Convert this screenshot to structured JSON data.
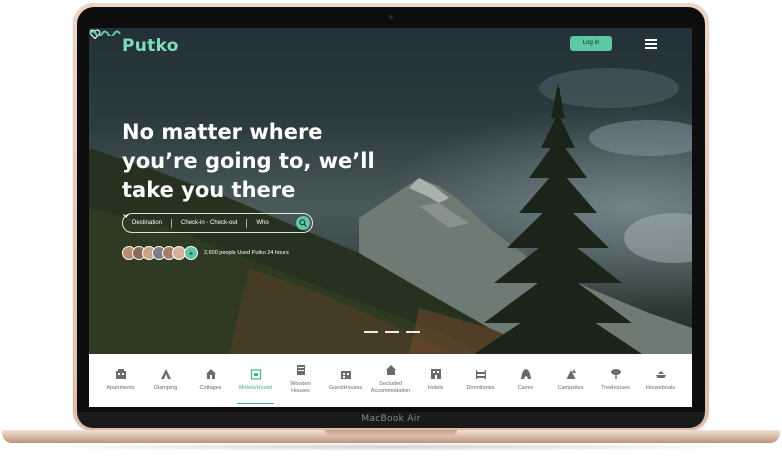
{
  "device": {
    "model_label": "MacBook Air"
  },
  "header": {
    "logo": "Putko",
    "login_label": "Log in",
    "icons": [
      "heart-icon",
      "menu-icon"
    ]
  },
  "hero": {
    "headline_lines": [
      "No matter where",
      "you’re going to, we’ll",
      "take you there"
    ],
    "search": {
      "destination": "Destination",
      "dates": "Check-in - Check-out",
      "who": "Who"
    },
    "social_proof": "2,600 people Used Putko 24 hours",
    "avatar_plus": "+",
    "slide_count": 3
  },
  "categories": [
    {
      "label": "Apartments",
      "icon": "apartments-icon"
    },
    {
      "label": "Glamping",
      "icon": "glamping-icon"
    },
    {
      "label": "Cottages",
      "icon": "cottages-icon"
    },
    {
      "label": "Motels/Hostel",
      "icon": "motels-icon",
      "active": true
    },
    {
      "label": "Wooden\nHouses",
      "icon": "wooden-houses-icon"
    },
    {
      "label": "GuestHouses",
      "icon": "guesthouses-icon"
    },
    {
      "label": "Secluded\nAccommodation",
      "icon": "secluded-icon"
    },
    {
      "label": "Hotels",
      "icon": "hotels-icon"
    },
    {
      "label": "Dormitories",
      "icon": "dormitories-icon"
    },
    {
      "label": "Caves",
      "icon": "caves-icon"
    },
    {
      "label": "Campsites",
      "icon": "campsites-icon"
    },
    {
      "label": "Treehouses",
      "icon": "treehouses-icon"
    },
    {
      "label": "Houseboats",
      "icon": "houseboats-icon"
    }
  ],
  "colors": {
    "accent": "#5ec7a3",
    "accent_dark": "#3bb38c",
    "logo": "#7fdcbf"
  }
}
